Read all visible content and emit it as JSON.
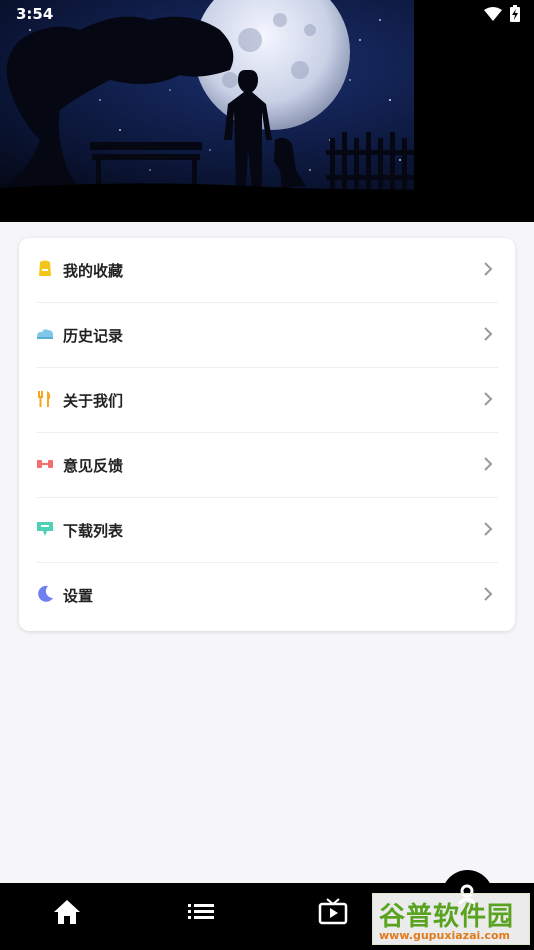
{
  "status_bar": {
    "time": "3:54",
    "icons": [
      "wifi-icon",
      "battery-charging-icon"
    ]
  },
  "hero": {
    "image": "night-sky-moon-silhouette"
  },
  "menu": {
    "items": [
      {
        "label": "我的收藏",
        "icon": "bookmark-icon",
        "color": "#f5c518"
      },
      {
        "label": "历史记录",
        "icon": "history-cloud-icon",
        "color": "#7fc8e8"
      },
      {
        "label": "关于我们",
        "icon": "utensils-icon",
        "color": "#f5a623"
      },
      {
        "label": "意见反馈",
        "icon": "dumbbell-icon",
        "color": "#f07070"
      },
      {
        "label": "下载列表",
        "icon": "download-icon",
        "color": "#4fd1b5"
      },
      {
        "label": "设置",
        "icon": "moon-icon",
        "color": "#6f7ef0"
      }
    ]
  },
  "bottom_nav": {
    "items": [
      {
        "icon": "home-icon"
      },
      {
        "icon": "list-icon"
      },
      {
        "icon": "tv-icon"
      }
    ],
    "fab_icon": "person-icon"
  },
  "watermark": {
    "title": "谷普软件园",
    "url": "www.gupuxiazai.com"
  }
}
